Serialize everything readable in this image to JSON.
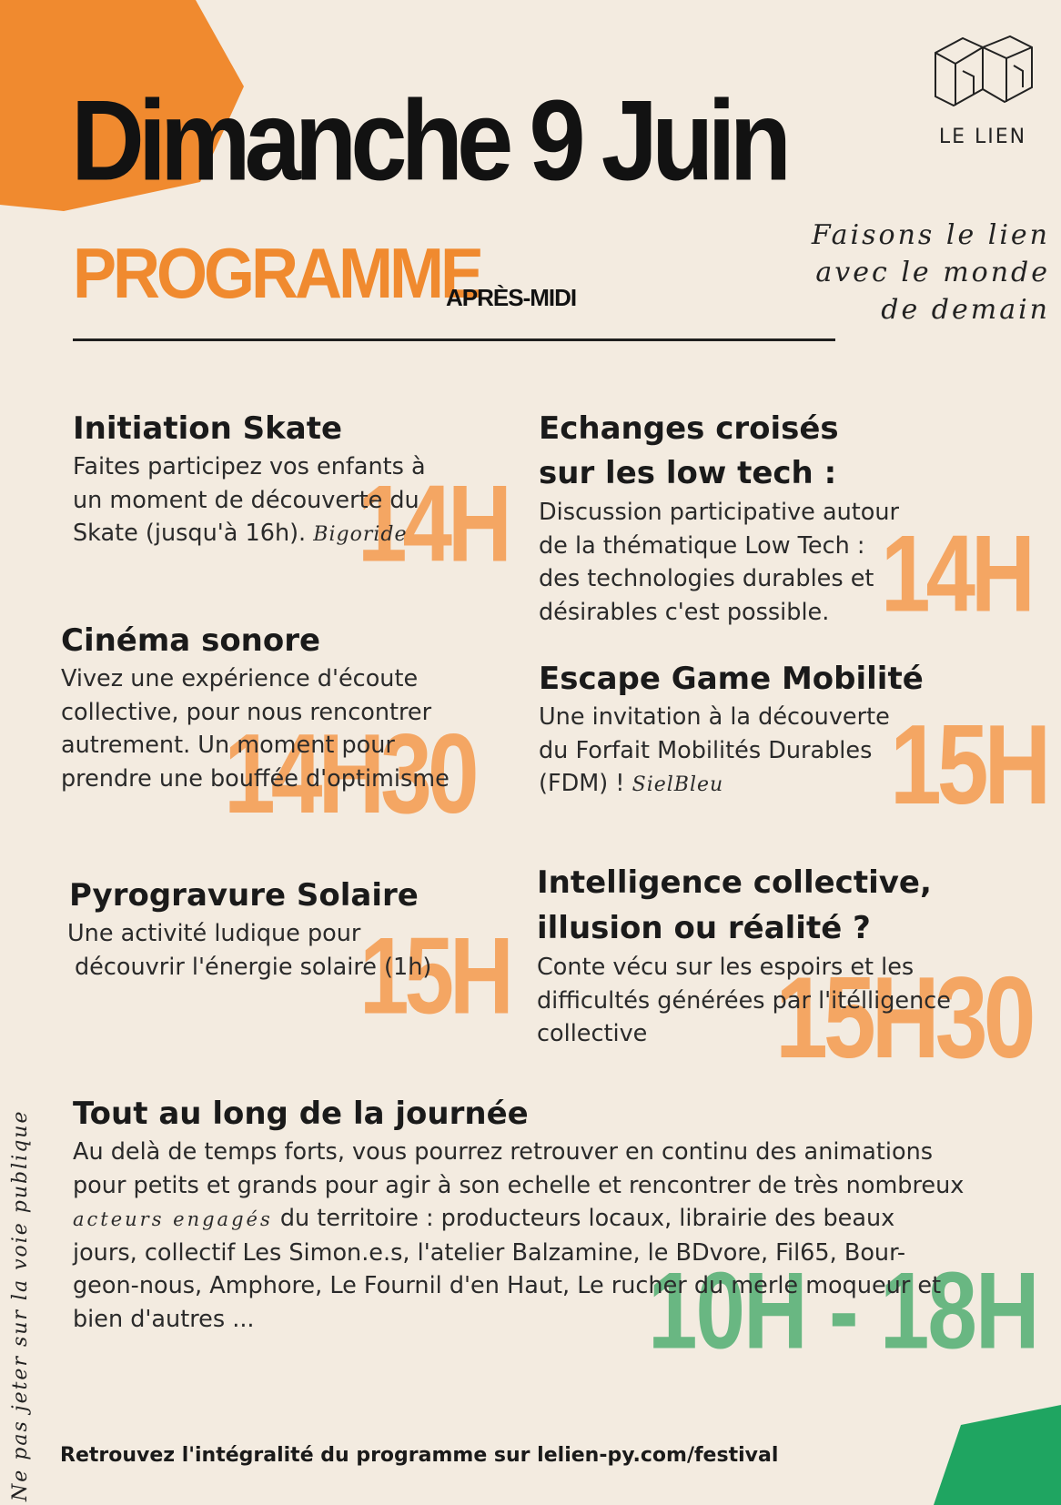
{
  "colors": {
    "background": "#f3ebe0",
    "orange": "#f08a2f",
    "time_orange": "#f5a15a",
    "green": "#62b57d",
    "dark": "#121212"
  },
  "logo": {
    "icon": "le-lien-logo-icon",
    "text": "LE LIEN"
  },
  "header": {
    "title": "Dimanche 9 Juin",
    "programme": "PROGRAMME",
    "period": "APRÈS-MIDI"
  },
  "tagline": {
    "line1": "Faisons le lien",
    "line2": "avec le monde",
    "line3": "de demain"
  },
  "events": {
    "skate": {
      "title": "Initiation Skate",
      "l1": "Faites participez vos enfants à",
      "l2": "un moment de découverte du",
      "l3": "Skate (jusqu'à 16h).",
      "sig": "Bigoride",
      "time": "14H"
    },
    "lowtech": {
      "title1": "Echanges croisés",
      "title2": "sur les low tech :",
      "l1": "Discussion participative autour",
      "l2": "de la thématique Low Tech :",
      "l3": "des technologies durables et",
      "l4": "désirables c'est possible.",
      "time": "14H"
    },
    "cinema": {
      "title": "Cinéma sonore",
      "l1": "Vivez une expérience d'écoute",
      "l2": "collective, pour nous rencontrer",
      "l3": "autrement. Un moment pour",
      "l4": "prendre une bouffée d'optimisme",
      "time": "14H30"
    },
    "escape": {
      "title": "Escape Game Mobilité",
      "l1": "Une invitation à la découverte",
      "l2": "du Forfait Mobilités Durables",
      "l3": "(FDM) !",
      "sig": "SielBleu",
      "time": "15H"
    },
    "pyro": {
      "title": "Pyrogravure Solaire",
      "l1": "Une activité ludique pour",
      "l2": "découvrir l'énergie solaire (1h)",
      "time": "15H"
    },
    "intel": {
      "title1": "Intelligence collective,",
      "title2": "illusion ou réalité ?",
      "l1": "Conte vécu sur les espoirs et les",
      "l2": "difficultés générées par l'itélligence",
      "l3": "collective",
      "time": "15H30"
    }
  },
  "allday": {
    "title": "Tout au long de la journée",
    "l1": "Au delà de temps forts, vous pourrez retrouver en continu des animations",
    "l2": "pour petits et grands pour agir à son echelle et rencontrer de très nombreux",
    "l3_script": "acteurs engagés",
    "l3": " du territoire : producteurs locaux, librairie des beaux",
    "l4": "jours, collectif Les Simon.e.s, l'atelier Balzamine, le BDvore, Fil65, Bour-",
    "l5": "geon-nous, Amphore, Le Fournil d'en Haut, Le rucher du merle moqueur et",
    "l6": "bien d'autres ...",
    "time": "10H - 18H"
  },
  "side_note": "Ne pas jeter sur la voie publique",
  "footer": "Retrouvez l'intégralité du programme sur lelien-py.com/festival"
}
